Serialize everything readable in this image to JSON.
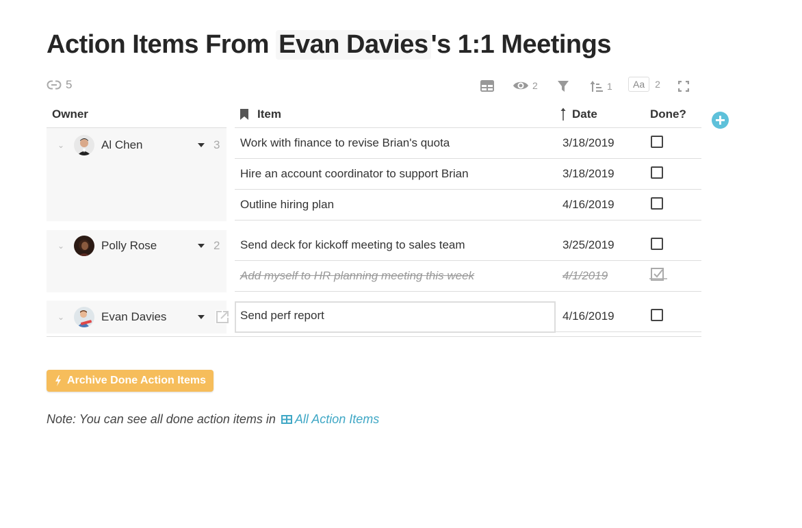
{
  "page": {
    "title_prefix": "Action Items From ",
    "title_ref": "Evan Davies",
    "title_suffix": "'s 1:1 Meetings",
    "backlinks_count": "5"
  },
  "toolbar": {
    "view_icon": "table-icon",
    "visible_count": "2",
    "filter_icon": "filter-icon",
    "sort_count": "1",
    "text_label": "Aa",
    "text_count": "2",
    "fullscreen_icon": "fullscreen-icon"
  },
  "columns": {
    "owner": "Owner",
    "item": "Item",
    "date": "Date",
    "done": "Done?"
  },
  "groups": [
    {
      "owner": "Al Chen",
      "count": "3",
      "rows": [
        {
          "item": "Work with finance to revise Brian's quota",
          "date": "3/18/2019",
          "done": false
        },
        {
          "item": "Hire an account coordinator to support Brian",
          "date": "3/18/2019",
          "done": false
        },
        {
          "item": "Outline hiring plan",
          "date": "4/16/2019",
          "done": false
        }
      ]
    },
    {
      "owner": "Polly Rose",
      "count": "2",
      "rows": [
        {
          "item": "Send deck for kickoff meeting to sales team",
          "date": "3/25/2019",
          "done": false
        },
        {
          "item": "Add myself to HR planning meeting this week",
          "date": "4/1/2019",
          "done": true
        }
      ]
    },
    {
      "owner": "Evan Davies",
      "count": "",
      "rows": [
        {
          "item": "Send perf report",
          "date": "4/16/2019",
          "done": false
        }
      ]
    }
  ],
  "actions": {
    "archive_label": "Archive Done Action Items"
  },
  "note": {
    "text": "Note: You can see all done action items in",
    "link_label": "All Action Items"
  },
  "colors": {
    "accent": "#5ec1da",
    "archive_button": "#f6bd5b",
    "link": "#3fa7c5"
  }
}
